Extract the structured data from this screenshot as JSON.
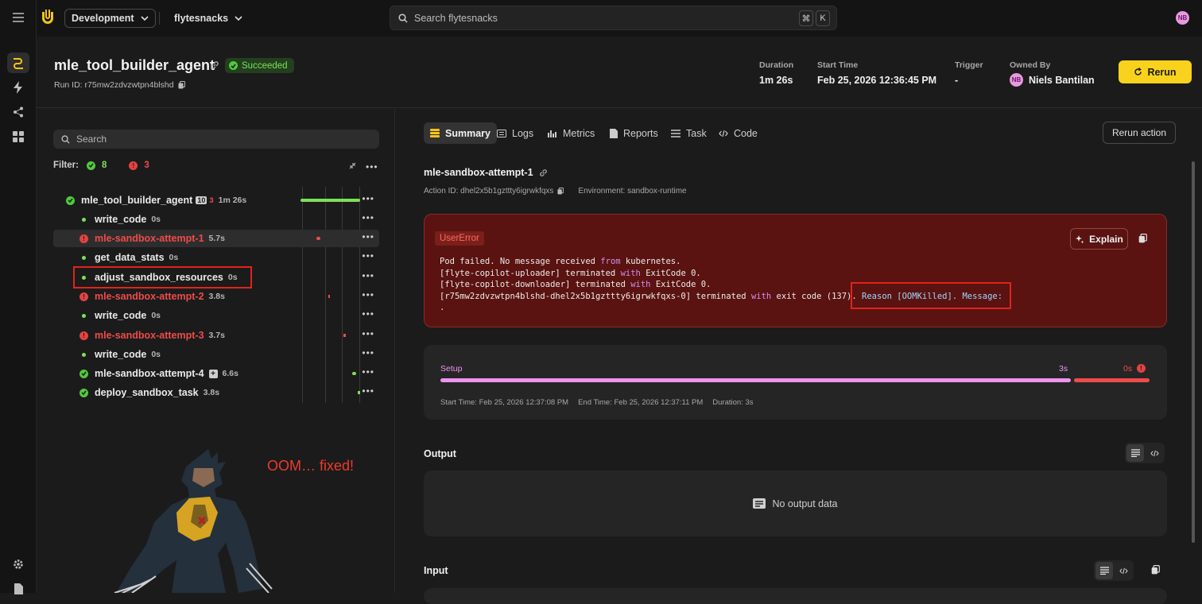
{
  "topbar": {
    "env_label": "Development",
    "project_label": "flytesnacks",
    "search_placeholder": "Search flytesnacks",
    "kbd_cmd": "⌘",
    "kbd_k": "K",
    "user_initials": "NB"
  },
  "header": {
    "title": "mle_tool_builder_agent",
    "status": "Succeeded",
    "run_id": "Run ID: r75mw2zdvzwtpn4blshd",
    "duration_label": "Duration",
    "duration_value": "1m 26s",
    "start_label": "Start Time",
    "start_value": "Feb 25, 2026 12:36:45 PM",
    "trigger_label": "Trigger",
    "trigger_value": "-",
    "owner_label": "Owned By",
    "owner_initials": "NB",
    "owner_value": "Niels Bantilan",
    "rerun_label": "Rerun"
  },
  "tree": {
    "search_placeholder": "Search",
    "filter_label": "Filter:",
    "success_count": "8",
    "failed_count": "3",
    "root": {
      "label": "mle_tool_builder_agent",
      "child_badge": "10",
      "fail_badge": "3",
      "duration": "1m 26s"
    },
    "rows": [
      {
        "label": "write_code",
        "duration": "0s"
      },
      {
        "label": "mle-sandbox-attempt-1",
        "duration": "5.7s"
      },
      {
        "label": "get_data_stats",
        "duration": "0s"
      },
      {
        "label": "adjust_sandbox_resources",
        "duration": "0s"
      },
      {
        "label": "mle-sandbox-attempt-2",
        "duration": "3.8s"
      },
      {
        "label": "write_code",
        "duration": "0s"
      },
      {
        "label": "mle-sandbox-attempt-3",
        "duration": "3.7s"
      },
      {
        "label": "write_code",
        "duration": "0s"
      },
      {
        "label": "mle-sandbox-attempt-4",
        "duration": "6.6s"
      },
      {
        "label": "deploy_sandbox_task",
        "duration": "3.8s"
      }
    ]
  },
  "annotation": {
    "text": "OOM… fixed!"
  },
  "detail": {
    "tabs": [
      "Summary",
      "Logs",
      "Metrics",
      "Reports",
      "Task",
      "Code"
    ],
    "rerun_action_label": "Rerun action",
    "action_name": "mle-sandbox-attempt-1",
    "action_id": "Action ID: dhel2x5b1gzttty6igrwkfqxs",
    "environment": "Environment: sandbox-runtime",
    "error": {
      "tag": "UserError",
      "explain_label": "Explain",
      "lines": {
        "l1a": "Pod failed. No message received ",
        "l1kw": "from",
        "l1b": " kubernetes.",
        "l2a": "[flyte-copilot-uploader] terminated ",
        "l2kw": "with",
        "l2b": " ExitCode 0.",
        "l3a": "[flyte-copilot-downloader] terminated ",
        "l3kw": "with",
        "l3b": " ExitCode 0.",
        "l4a": "[r75mw2zdvzwtpn4blshd-dhel2x5b1gzttty6igrwkfqxs-0] terminated ",
        "l4kw": "with",
        "l4b": " exit code (137). ",
        "l4c": "Reason [OOMKilled]. Message:",
        "l5": "."
      }
    },
    "setup": {
      "label": "Setup",
      "setup_time": "3s",
      "fail_time": "0s",
      "start_time": "Start Time: Feb 25, 2026 12:37:08 PM",
      "end_time": "End Time: Feb 25, 2026 12:37:11 PM",
      "duration": "Duration: 3s"
    },
    "output_title": "Output",
    "output_empty": "No output data",
    "input_title": "Input"
  },
  "colors": {
    "accent": "#f8d21c",
    "success": "#4fcb3c",
    "error": "#e34242",
    "setup_bar": "#ee93ee"
  }
}
